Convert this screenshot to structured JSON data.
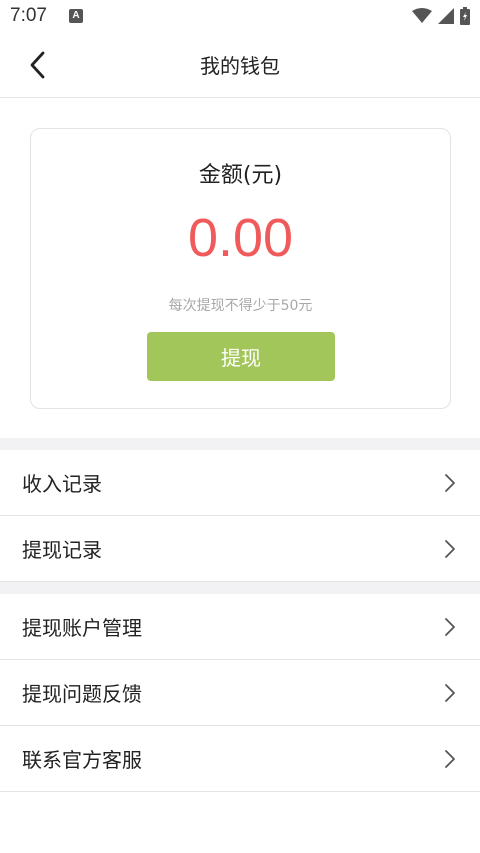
{
  "status_bar": {
    "time": "7:07",
    "notification_glyph": "A",
    "icons": [
      "wifi-icon",
      "signal-icon",
      "battery-icon"
    ]
  },
  "header": {
    "title": "我的钱包",
    "back_icon": "chevron-left-icon"
  },
  "wallet": {
    "label": "金额(元)",
    "amount": "0.00",
    "hint": "每次提现不得少于50元",
    "withdraw_label": "提现",
    "colors": {
      "amount": "#f05a5a",
      "button": "#a3c65a"
    }
  },
  "menu_group_1": [
    {
      "label": "收入记录"
    },
    {
      "label": "提现记录"
    }
  ],
  "menu_group_2": [
    {
      "label": "提现账户管理"
    },
    {
      "label": "提现问题反馈"
    },
    {
      "label": "联系官方客服"
    }
  ]
}
